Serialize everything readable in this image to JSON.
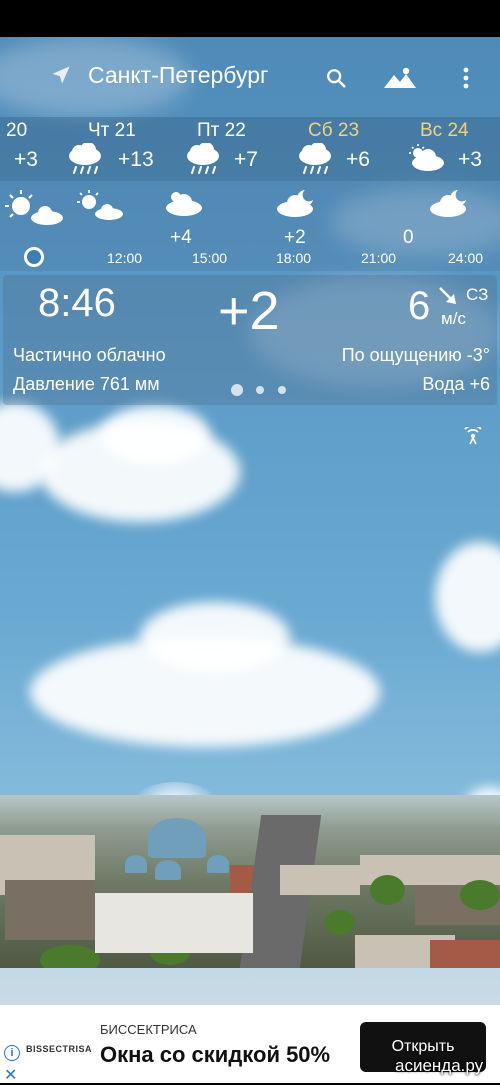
{
  "header": {
    "city": "Санкт-Петербург",
    "icons": [
      "location-arrow-icon",
      "search-icon",
      "landscape-icon",
      "more-vert-icon"
    ]
  },
  "forecast": [
    {
      "day": "20",
      "temp": "+3",
      "icon": "partial"
    },
    {
      "day": "Чт 21",
      "temp": "+13",
      "icon": "rain-cloud-icon"
    },
    {
      "day": "Пт 22",
      "temp": "+7",
      "icon": "rain-cloud-icon"
    },
    {
      "day": "Сб 23",
      "temp": "+6",
      "icon": "rain-cloud-icon",
      "highlight": "#f2d27a"
    },
    {
      "day": "Вс 24",
      "temp": "+3",
      "icon": "sun-cloud-icon",
      "highlight": "#f2d27a"
    }
  ],
  "hourly": {
    "temps": [
      "+4",
      "+2",
      "0"
    ],
    "times": [
      "12:00",
      "15:00",
      "18:00",
      "21:00",
      "24:00"
    ]
  },
  "current": {
    "time": "8:46",
    "temp": "+2",
    "wind_speed": "6",
    "wind_dir": "СЗ",
    "wind_unit": "м/с",
    "condition": "Частично облачно",
    "feels_like": "По ощущению -3°",
    "pressure": "Давление 761 мм",
    "water": "Вода +6"
  },
  "ad": {
    "logo": "BISSECTRISA",
    "brand": "БИССЕКТРИСА",
    "title": "Окна со скидкой 50%",
    "button": "Открыть"
  },
  "watermark": "асиенда.ру",
  "colors": {
    "accent_weekend": "#f2d27a",
    "ad_button": "#111111"
  }
}
